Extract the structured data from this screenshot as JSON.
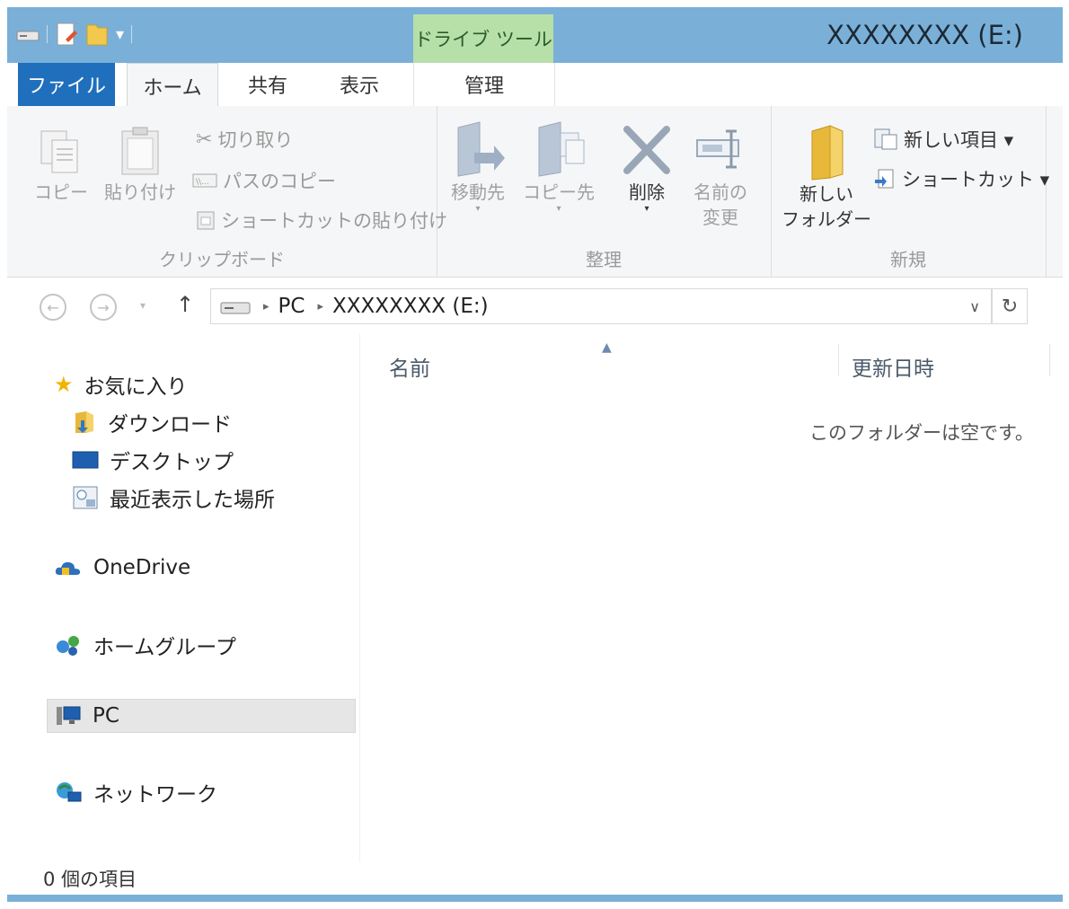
{
  "window": {
    "title": "XXXXXXXX (E:)",
    "context_group": "ドライブ ツール",
    "accent": "#1f6fbd",
    "frame_color": "#7ab0d8"
  },
  "tabs": {
    "file": "ファイル",
    "home": "ホーム",
    "share": "共有",
    "view": "表示",
    "manage": "管理"
  },
  "ribbon": {
    "clipboard": {
      "label": "クリップボード",
      "copy": "コピー",
      "paste": "貼り付け",
      "cut": "切り取り",
      "copy_path": "パスのコピー",
      "paste_shortcut": "ショートカットの貼り付け"
    },
    "organize": {
      "label": "整理",
      "move_to": "移動先",
      "copy_to": "コピー先",
      "delete": "削除",
      "rename": "名前の\n変更"
    },
    "new": {
      "label": "新規",
      "new_folder": "新しい\nフォルダー",
      "new_item": "新しい項目 ▾",
      "shortcut": "ショートカット ▾"
    }
  },
  "address": {
    "crumb_pc": "PC",
    "crumb_drive": "XXXXXXXX (E:)"
  },
  "nav": {
    "favorites": "お気に入り",
    "downloads": "ダウンロード",
    "desktop": "デスクトップ",
    "recent": "最近表示した場所",
    "onedrive": "OneDrive",
    "homegroup": "ホームグループ",
    "pc": "PC",
    "network": "ネットワーク"
  },
  "columns": {
    "name": "名前",
    "modified": "更新日時"
  },
  "empty_message": "このフォルダーは空です。",
  "status": {
    "item_count": "0 個の項目"
  }
}
